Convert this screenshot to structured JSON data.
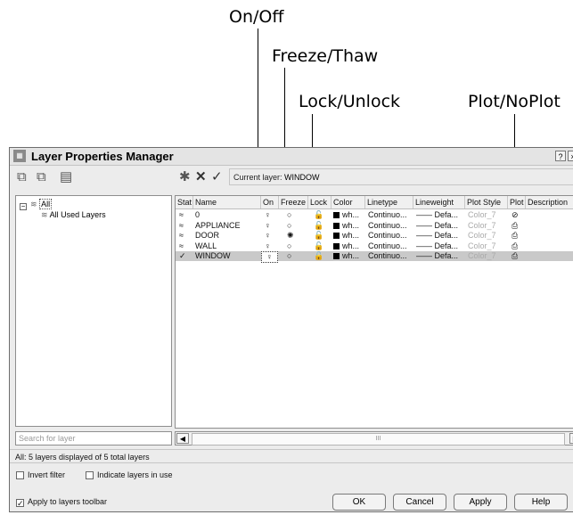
{
  "callouts": {
    "on_off": "On/Off",
    "freeze_thaw": "Freeze/Thaw",
    "lock_unlock": "Lock/Unlock",
    "plot_noplot": "Plot/NoPlot"
  },
  "window": {
    "title": "Layer Properties Manager",
    "help_glyph": "?",
    "close_glyph": "×"
  },
  "toolbar": {
    "current_layer_label": "Current layer:",
    "current_layer_value": "WINDOW"
  },
  "tree": {
    "root_label": "All",
    "child_label": "All Used Layers"
  },
  "search": {
    "placeholder": "Search for layer"
  },
  "columns": [
    "Stat",
    "Name",
    "On",
    "Freeze",
    "Lock",
    "Color",
    "Linetype",
    "Lineweight",
    "Plot Style",
    "Plot",
    "Description"
  ],
  "layers": [
    {
      "name": "0",
      "color": "wh...",
      "linetype": "Continuo...",
      "lineweight": "Defa...",
      "plot_style": "Color_7",
      "on": true,
      "frozen": false,
      "locked": false,
      "plot": false,
      "current": false
    },
    {
      "name": "APPLIANCE",
      "color": "wh...",
      "linetype": "Continuo...",
      "lineweight": "Defa...",
      "plot_style": "Color_7",
      "on": true,
      "frozen": false,
      "locked": false,
      "plot": true,
      "current": false
    },
    {
      "name": "DOOR",
      "color": "wh...",
      "linetype": "Continuo...",
      "lineweight": "Defa...",
      "plot_style": "Color_7",
      "on": true,
      "frozen": true,
      "locked": false,
      "plot": true,
      "current": false
    },
    {
      "name": "WALL",
      "color": "wh...",
      "linetype": "Continuo...",
      "lineweight": "Defa...",
      "plot_style": "Color_7",
      "on": true,
      "frozen": false,
      "locked": false,
      "plot": true,
      "current": false
    },
    {
      "name": "WINDOW",
      "color": "wh...",
      "linetype": "Continuo...",
      "lineweight": "Defa...",
      "plot_style": "Color_7",
      "on": true,
      "frozen": false,
      "locked": false,
      "plot": true,
      "current": true
    }
  ],
  "scrollbar": {
    "middle_glyph": "III"
  },
  "status": "All: 5 layers displayed of 5 total layers",
  "options": {
    "invert_filter": {
      "label": "Invert filter",
      "checked": false
    },
    "indicate_in_use": {
      "label": "Indicate layers in use",
      "checked": false
    },
    "apply_toolbar": {
      "label": "Apply to layers toolbar",
      "checked": true
    }
  },
  "buttons": {
    "ok": "OK",
    "cancel": "Cancel",
    "apply": "Apply",
    "help": "Help"
  }
}
